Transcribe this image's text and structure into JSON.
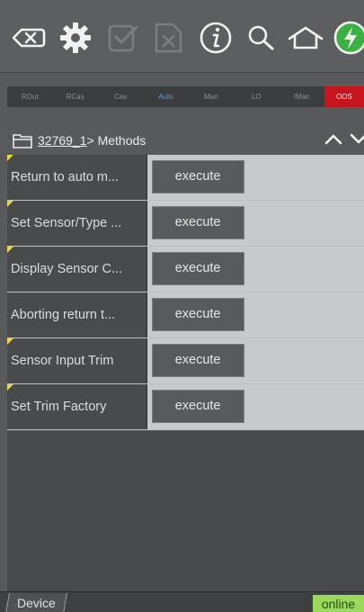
{
  "toolbar": {
    "icons": [
      "backspace-icon",
      "gear-icon",
      "checkbox-doc-icon",
      "close-doc-icon",
      "info-icon",
      "search-icon",
      "home-icon",
      "power-icon"
    ],
    "accent": "#3bb143"
  },
  "modes": {
    "items": [
      "ROut",
      "RCas",
      "Cas",
      "Auto",
      "Man",
      "LO",
      "IMan",
      "OOS"
    ],
    "active": "Auto",
    "oos_color": "#c8141d"
  },
  "breadcrumb": {
    "link": "32769_1",
    "rest": "> Methods"
  },
  "methods": [
    {
      "label": "Return to auto m...",
      "button": "execute",
      "flag": true
    },
    {
      "label": "Set Sensor/Type ...",
      "button": "execute",
      "flag": true
    },
    {
      "label": "Display Sensor C...",
      "button": "execute",
      "flag": true
    },
    {
      "label": "Aborting return t...",
      "button": "execute",
      "flag": false
    },
    {
      "label": "Sensor Input Trim",
      "button": "execute",
      "flag": true
    },
    {
      "label": "Set Trim Factory",
      "button": "execute",
      "flag": true
    }
  ],
  "footer": {
    "tab": "Device",
    "status": "online",
    "status_color": "#9ad95b"
  }
}
